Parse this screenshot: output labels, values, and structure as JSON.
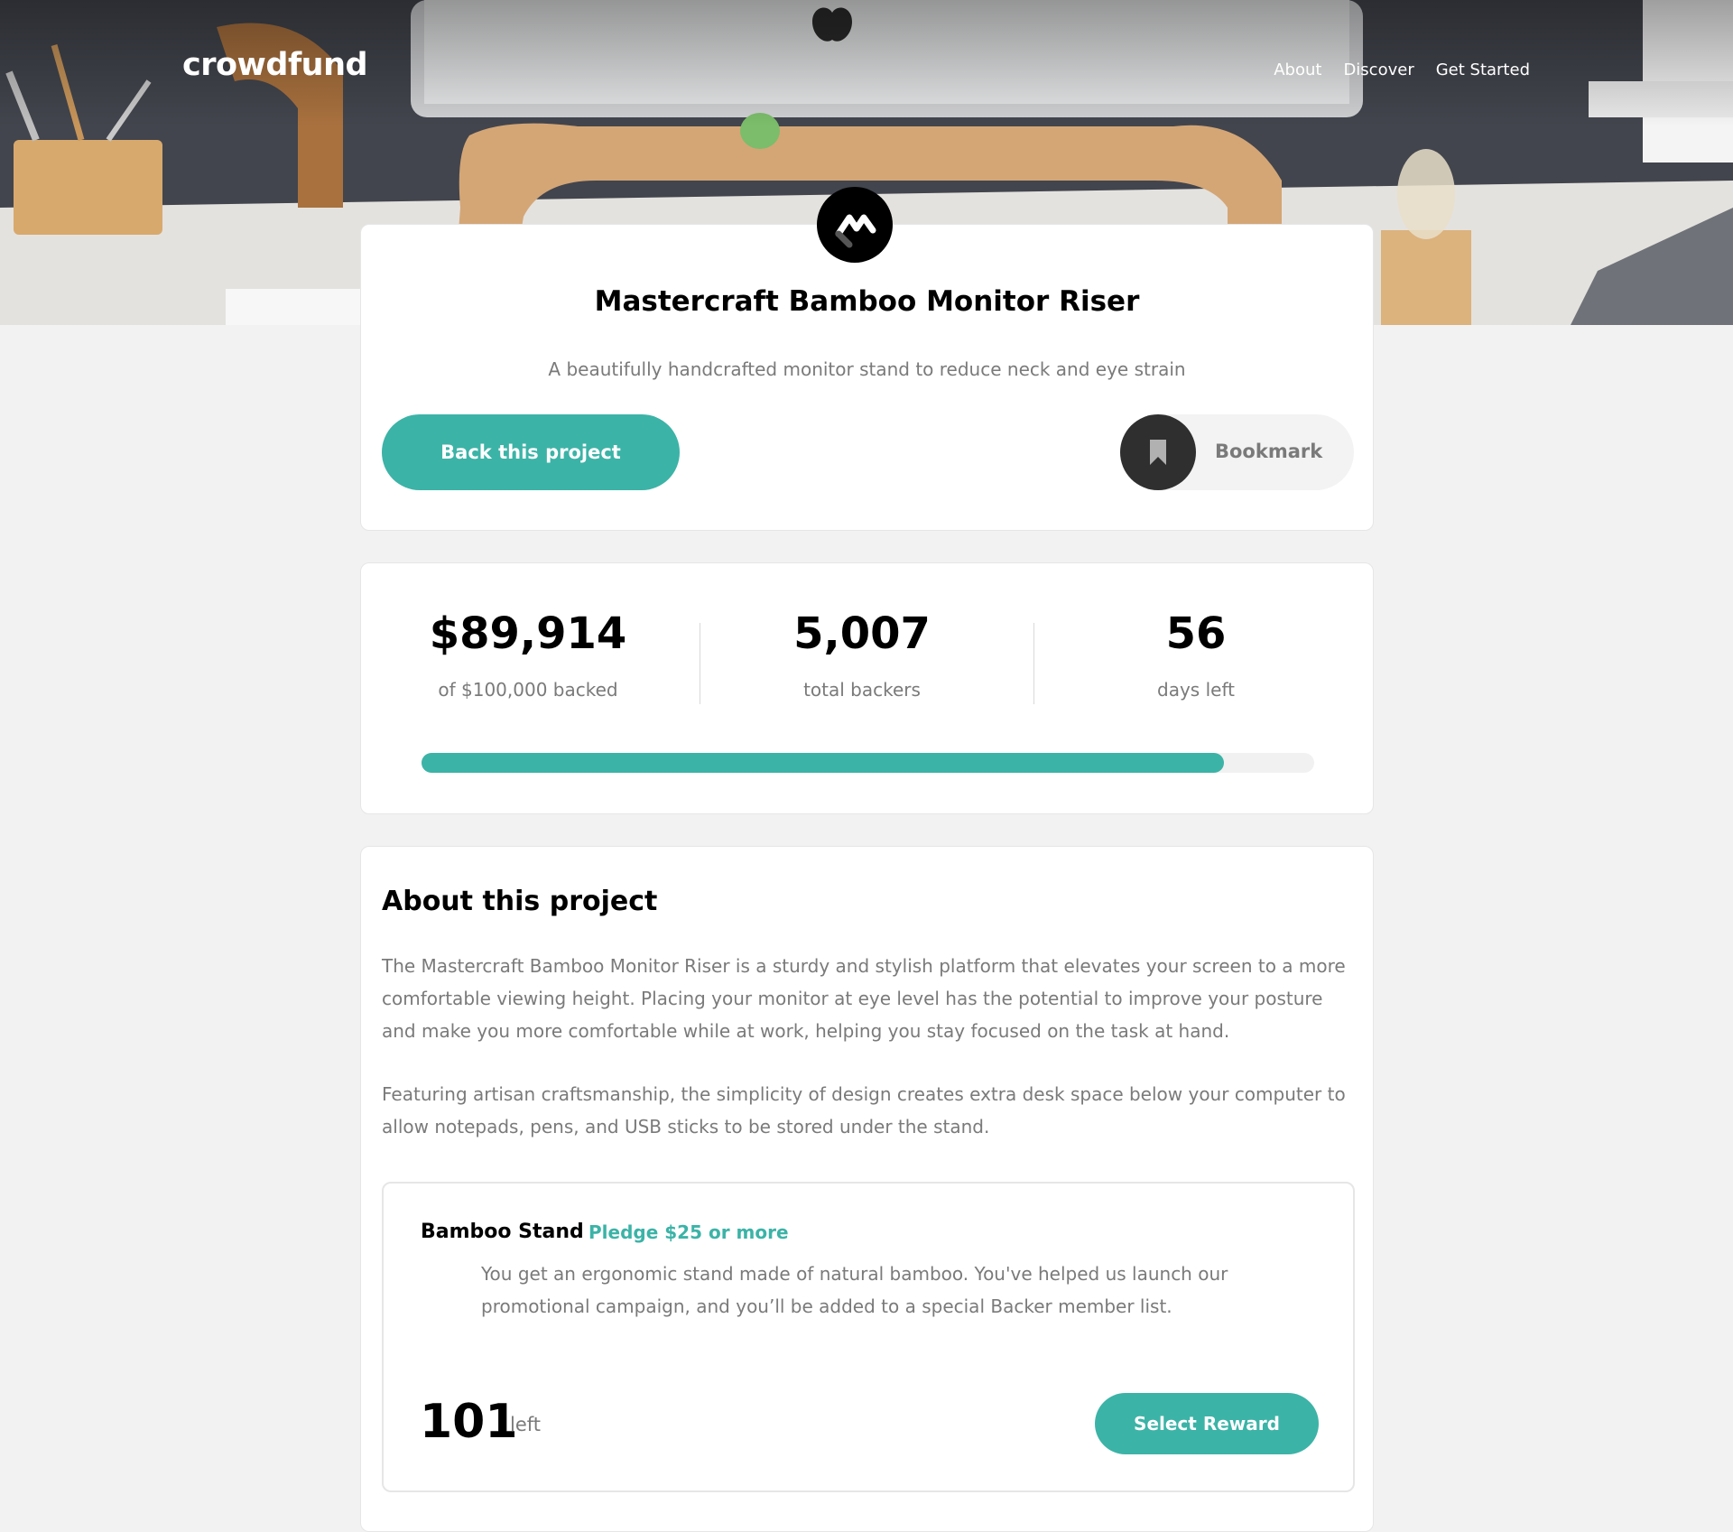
{
  "header": {
    "logo": "crowdfund",
    "nav": [
      "About",
      "Discover",
      "Get Started"
    ]
  },
  "project": {
    "title": "Mastercraft Bamboo Monitor Riser",
    "subtitle": "A beautifully handcrafted monitor stand to reduce neck and eye strain",
    "back_label": "Back this project",
    "bookmark_label": "Bookmark"
  },
  "stats": {
    "amount": "$89,914",
    "amount_label": "of $100,000 backed",
    "backers": "5,007",
    "backers_label": "total backers",
    "days": "56",
    "days_label": "days left",
    "progress_fraction": 0.899
  },
  "about": {
    "heading": "About this project",
    "paragraphs": [
      "The Mastercraft Bamboo Monitor Riser is a sturdy and stylish platform that elevates your screen to a more comfortable viewing height. Placing your monitor at eye level has the potential to improve your posture and make you more comfortable while at work, helping you stay focused on the task at hand.",
      "Featuring artisan craftsmanship, the simplicity of design creates extra desk space below your computer to allow notepads, pens, and USB sticks to be stored under the stand."
    ]
  },
  "rewards": [
    {
      "name": "Bamboo Stand",
      "pledge": "Pledge $25 or more",
      "description": "You get an ergonomic stand made of natural bamboo. You've helped us launch our promotional campaign, and you’ll be added to a special Backer member list.",
      "count": "101",
      "count_label": "left",
      "button": "Select Reward"
    }
  ],
  "icons": {
    "brand": "mastercraft-logo-icon",
    "bookmark": "bookmark-icon"
  },
  "colors": {
    "accent": "#3cb3a7",
    "dark": "#2f2f2f",
    "muted_text": "#7a7a7a",
    "page_background": "#f2f2f2"
  }
}
